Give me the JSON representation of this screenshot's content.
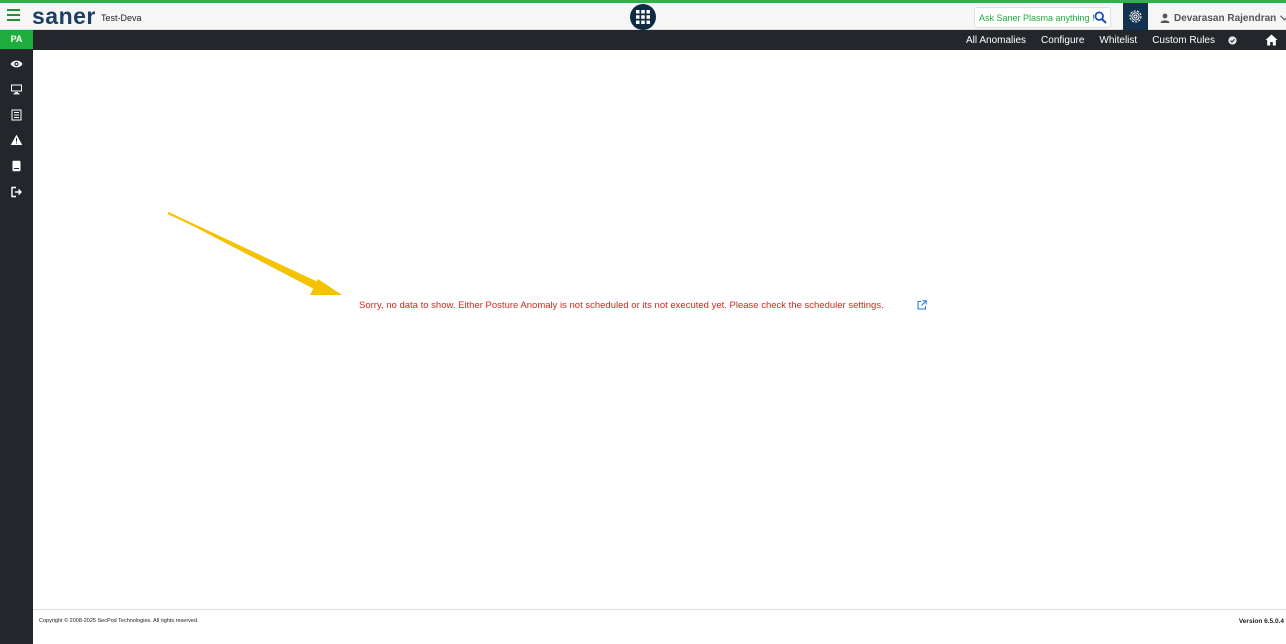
{
  "app": {
    "logo": "saner",
    "tenant": "Test-Deva"
  },
  "topbar": {
    "ask_prefix": "Ask Saner Plasma anything",
    "ask_suffix": "!",
    "user_name": "Devarasan Rajendran"
  },
  "sidebar": {
    "badge": "PA",
    "icons": [
      "eye-icon",
      "monitor-icon",
      "list-icon",
      "warning-icon",
      "book-icon",
      "logout-icon"
    ]
  },
  "nav": {
    "items": [
      "All Anomalies",
      "Configure",
      "Whitelist",
      "Custom Rules"
    ]
  },
  "main": {
    "message": "Sorry, no data to show. Either Posture Anomaly is not scheduled or its not executed yet. Please check the scheduler settings."
  },
  "footer": {
    "copyright": "Copyright © 2008-2025 SecPod Technologies. All rights reserved.",
    "version": "Version 6.5.0.4"
  },
  "colors": {
    "brand_green": "#2db34a",
    "dark_nav": "#23272b",
    "logo_navy": "#1d3f63",
    "error_red": "#d9261c",
    "arrow_yellow": "#f5c200"
  }
}
